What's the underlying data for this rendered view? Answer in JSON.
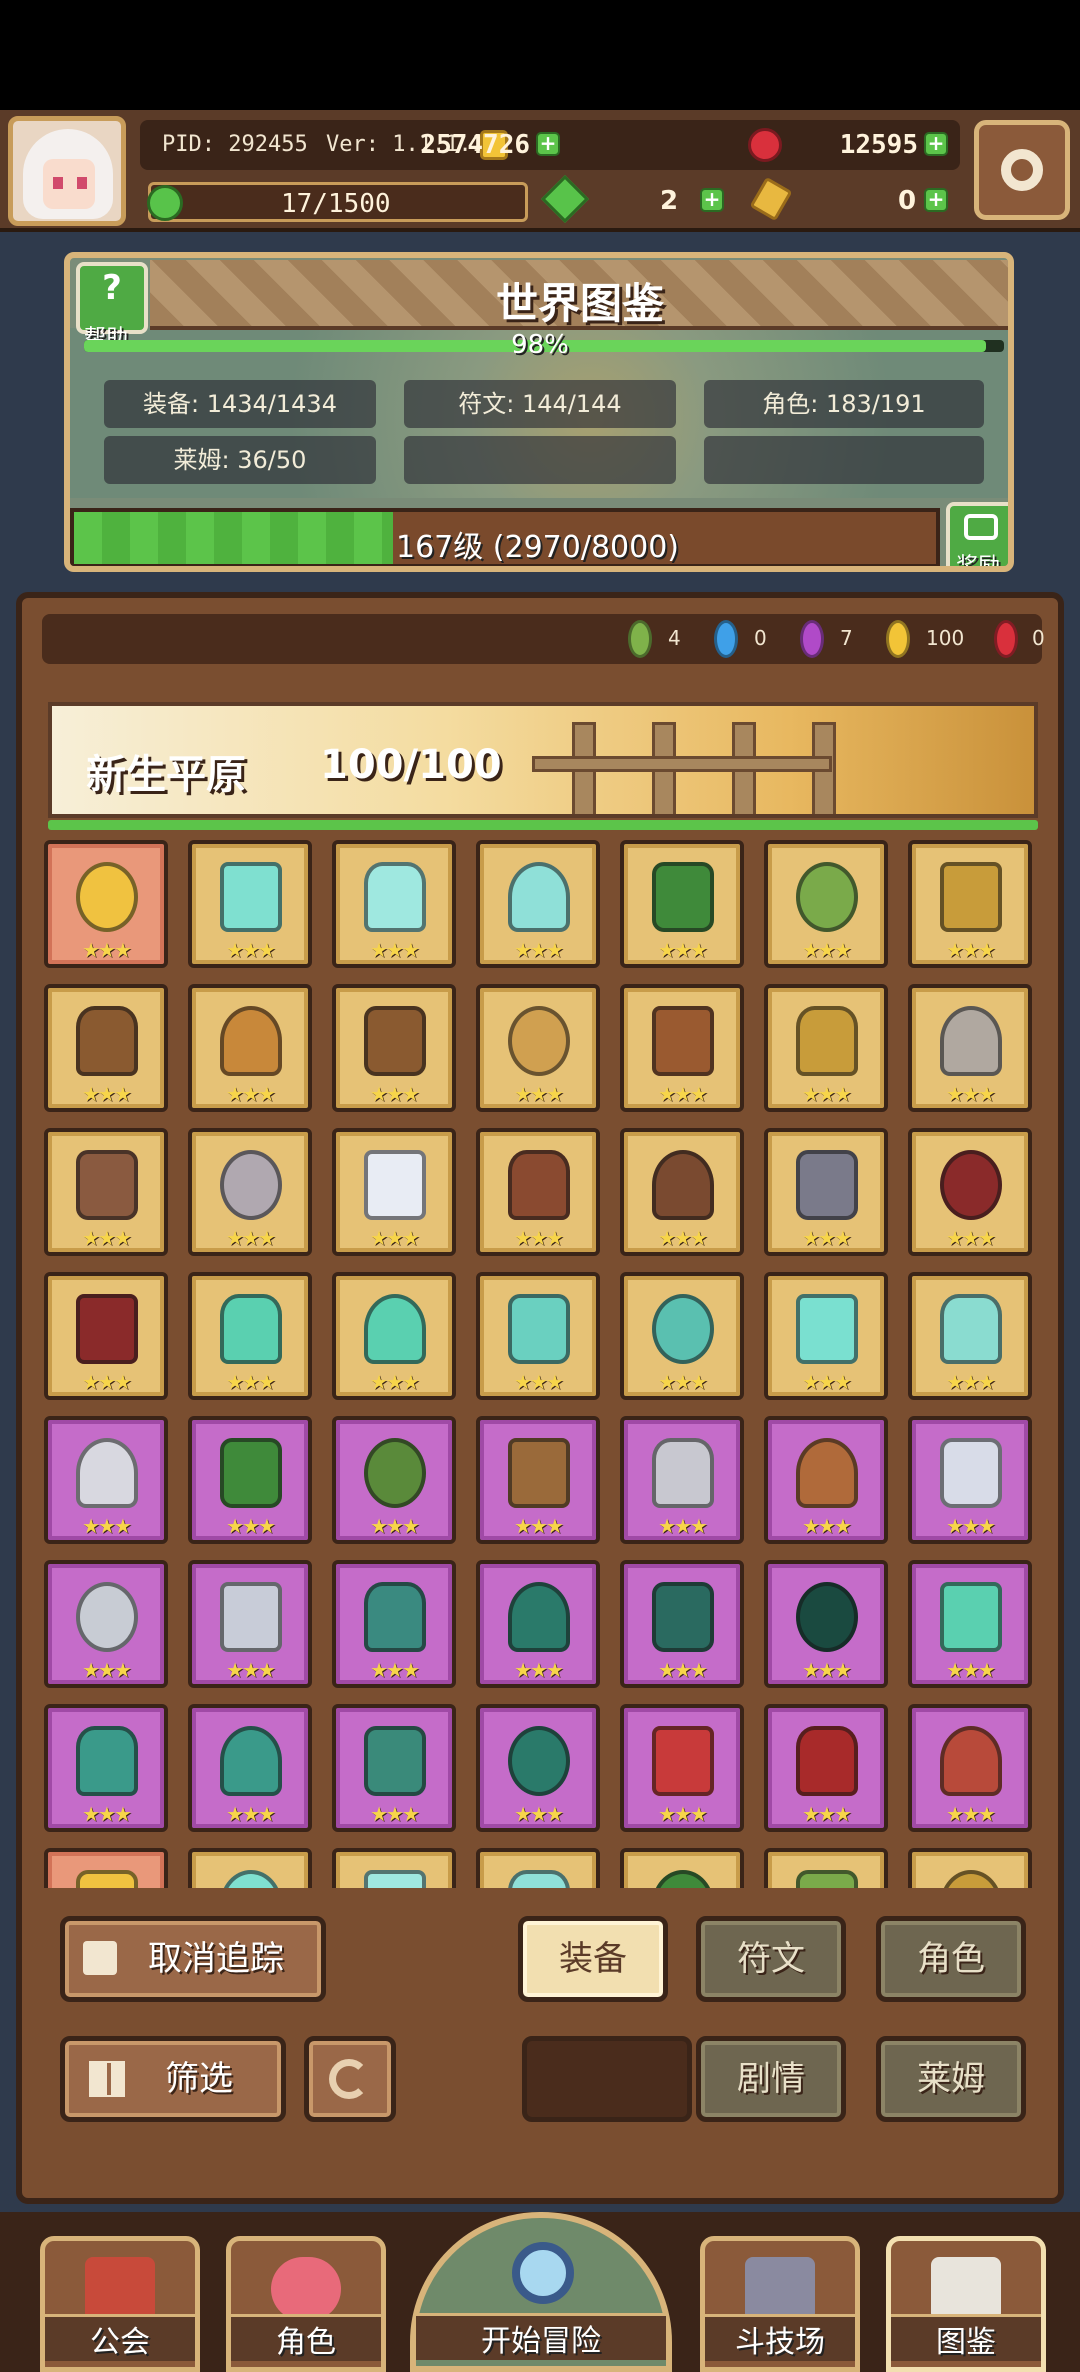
{
  "header": {
    "pid": "PID: 292455",
    "ver": "Ver: 1.1.1.11",
    "gold": "2574726",
    "rubies": "12595",
    "stamina": "17/1500",
    "gems": "2",
    "keys": "0"
  },
  "dex": {
    "title": "世界图鉴",
    "help_label": "帮助",
    "percent_text": "98%",
    "percent_value": 0.98,
    "stats": [
      {
        "label": "装备: 1434/1434"
      },
      {
        "label": "符文: 144/144"
      },
      {
        "label": "角色: 183/191"
      },
      {
        "label": "莱姆: 36/50"
      }
    ],
    "level_text": "167级 (2970/8000)",
    "level_progress": 0.37,
    "reward_label": "奖励"
  },
  "gem_counts": [
    {
      "color": "#7fb24a",
      "value": "4"
    },
    {
      "color": "#3fa0e8",
      "value": "0"
    },
    {
      "color": "#b04ac8",
      "value": "7"
    },
    {
      "color": "#f2c437",
      "value": "100"
    },
    {
      "color": "#d9303c",
      "value": "0"
    }
  ],
  "zone": {
    "name": "新生平原",
    "count": "100/100"
  },
  "items": [
    {
      "icon": "straw-hat-icon",
      "bg": "pink",
      "color": "#f0c240"
    },
    {
      "icon": "crystal-staff-icon",
      "bg": "gold",
      "color": "#7fe0d0"
    },
    {
      "icon": "crystal-orb-icon",
      "bg": "gold",
      "color": "#9fe8e0"
    },
    {
      "icon": "diamond-gem-icon",
      "bg": "gold",
      "color": "#8fe0d8"
    },
    {
      "icon": "green-helmet-icon",
      "bg": "gold",
      "color": "#3f8a3a"
    },
    {
      "icon": "green-armor-icon",
      "bg": "gold",
      "color": "#7aaa4a"
    },
    {
      "icon": "gold-ring-icon",
      "bg": "gold",
      "color": "#c89c3a"
    },
    {
      "icon": "crossbow-icon",
      "bg": "gold",
      "color": "#8a5a30"
    },
    {
      "icon": "spear-icon",
      "bg": "gold",
      "color": "#c8883a"
    },
    {
      "icon": "heart-amulet-icon",
      "bg": "gold",
      "color": "#8a5a30"
    },
    {
      "icon": "hammer-icon",
      "bg": "gold",
      "color": "#d0a050"
    },
    {
      "icon": "wood-ring-icon",
      "bg": "gold",
      "color": "#9a5a30"
    },
    {
      "icon": "gem-ring-icon",
      "bg": "gold",
      "color": "#c89c3a"
    },
    {
      "icon": "battle-axe-icon",
      "bg": "gold",
      "color": "#b0a8a0"
    },
    {
      "icon": "bracelet-icon",
      "bg": "gold",
      "color": "#8a5a40"
    },
    {
      "icon": "potion-jar-icon",
      "bg": "gold",
      "color": "#b0a8b0"
    },
    {
      "icon": "pearl-orb-icon",
      "bg": "gold",
      "color": "#e8ecf4"
    },
    {
      "icon": "brown-boots-icon",
      "bg": "gold",
      "color": "#8a4a30"
    },
    {
      "icon": "heart-necklace-icon",
      "bg": "gold",
      "color": "#7a4a30"
    },
    {
      "icon": "steel-sword-icon",
      "bg": "gold",
      "color": "#7a7a8a"
    },
    {
      "icon": "red-hood-icon",
      "bg": "gold",
      "color": "#8a2a2a"
    },
    {
      "icon": "red-cloak-icon",
      "bg": "gold",
      "color": "#8a2a2a"
    },
    {
      "icon": "jade-bow-icon",
      "bg": "gold",
      "color": "#5ad0b0"
    },
    {
      "icon": "jade-arrow-icon",
      "bg": "gold",
      "color": "#5ad0b0"
    },
    {
      "icon": "jade-boots-icon",
      "bg": "gold",
      "color": "#6ad0c0"
    },
    {
      "icon": "jade-helmet-icon",
      "bg": "gold",
      "color": "#5ac0b0"
    },
    {
      "icon": "jade-gloves-icon",
      "bg": "gold",
      "color": "#7ae0d0"
    },
    {
      "icon": "jade-crown-icon",
      "bg": "gold",
      "color": "#8adcd0"
    },
    {
      "icon": "silver-sword-icon",
      "bg": "purple",
      "color": "#d8d8e0"
    },
    {
      "icon": "green-hat-icon",
      "bg": "purple",
      "color": "#3f8a3a"
    },
    {
      "icon": "green-vest-icon",
      "bg": "purple",
      "color": "#5a8a3a"
    },
    {
      "icon": "longbow-icon",
      "bg": "purple",
      "color": "#9a6a3a"
    },
    {
      "icon": "silver-spear-icon",
      "bg": "purple",
      "color": "#c8c8d0"
    },
    {
      "icon": "leather-gloves-icon",
      "bg": "purple",
      "color": "#b06a3a"
    },
    {
      "icon": "silver-armor-icon",
      "bg": "purple",
      "color": "#d8dce8"
    },
    {
      "icon": "silver-ring-icon",
      "bg": "purple",
      "color": "#c8ccd4"
    },
    {
      "icon": "silver-boots-icon",
      "bg": "purple",
      "color": "#c8ccd8"
    },
    {
      "icon": "teal-scepter-icon",
      "bg": "purple",
      "color": "#3a8a80"
    },
    {
      "icon": "teal-wizard-hat-icon",
      "bg": "purple",
      "color": "#2a7a6a"
    },
    {
      "icon": "teal-armor-icon",
      "bg": "purple",
      "color": "#2a6a60"
    },
    {
      "icon": "teal-bracer-icon",
      "bg": "purple",
      "color": "#1a4a40"
    },
    {
      "icon": "teal-gem-icon",
      "bg": "purple",
      "color": "#5ad0b0"
    },
    {
      "icon": "teal-boots-icon",
      "bg": "purple",
      "color": "#3a9a8a"
    },
    {
      "icon": "teal-star-amulet-icon",
      "bg": "purple",
      "color": "#3a9a8a"
    },
    {
      "icon": "teal-necklace-icon",
      "bg": "purple",
      "color": "#3a8a7a"
    },
    {
      "icon": "teal-ring-icon",
      "bg": "purple",
      "color": "#2a7a6a"
    },
    {
      "icon": "red-mask-icon",
      "bg": "purple",
      "color": "#c83a3a"
    },
    {
      "icon": "red-robe-icon",
      "bg": "purple",
      "color": "#a82a2a"
    },
    {
      "icon": "red-boots-icon",
      "bg": "purple",
      "color": "#b84a3a"
    }
  ],
  "buttons": {
    "untrack": "取消追踪",
    "filter": "筛选",
    "equip": "装备",
    "rune": "符文",
    "character": "角色",
    "story": "剧情",
    "slime": "莱姆"
  },
  "nav": {
    "guild": "公会",
    "character": "角色",
    "adventure": "开始冒险",
    "arena": "斗技场",
    "dex": "图鉴"
  }
}
